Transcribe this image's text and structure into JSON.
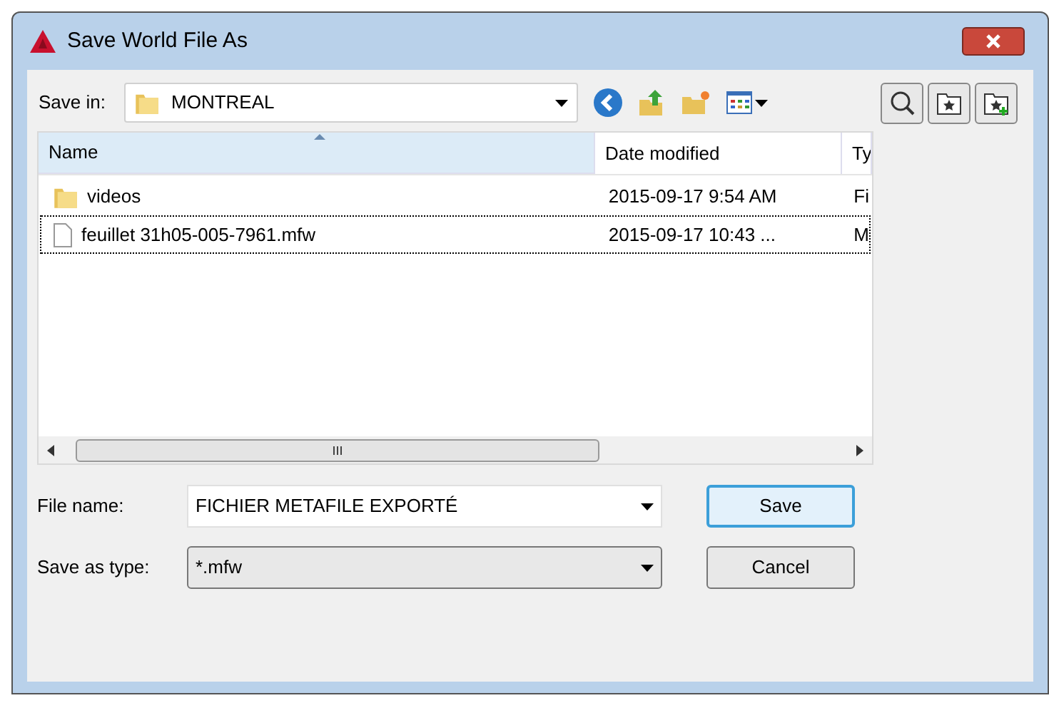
{
  "window": {
    "title": "Save World File As"
  },
  "save_in": {
    "label": "Save in:",
    "value": "MONTREAL"
  },
  "file_list": {
    "columns": [
      "Name",
      "Date modified",
      "Ty"
    ],
    "rows": [
      {
        "kind": "folder",
        "name": "videos",
        "date": "2015-09-17 9:54 AM",
        "type": "Fi",
        "focused": false
      },
      {
        "kind": "file",
        "name": "feuillet 31h05-005-7961.mfw",
        "date": "2015-09-17 10:43 ...",
        "type": "M",
        "focused": true
      }
    ]
  },
  "file_name": {
    "label": "File name:",
    "value": "FICHIER METAFILE EXPORTÉ"
  },
  "save_as_type": {
    "label": "Save as type:",
    "value": "*.mfw"
  },
  "buttons": [
    {
      "label": "Save",
      "default": true
    },
    {
      "label": "Cancel",
      "default": false
    }
  ]
}
